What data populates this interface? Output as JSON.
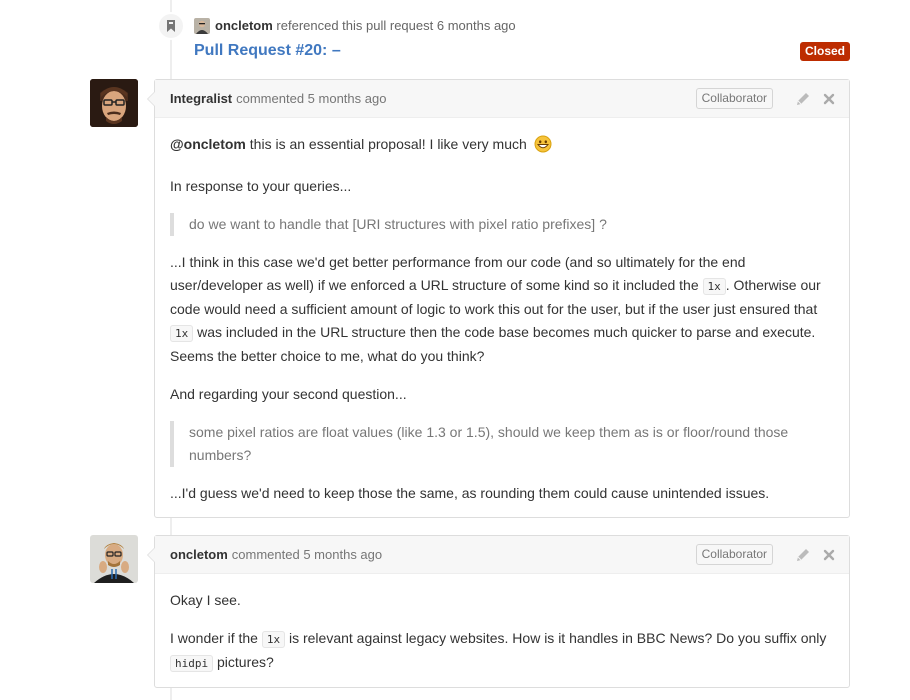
{
  "reference_event": {
    "author": "oncletom",
    "action": "referenced this pull request",
    "time": "6 months ago",
    "title": "Pull Request #20: –",
    "state": "Closed"
  },
  "comments": [
    {
      "author": "Integralist",
      "action": "commented",
      "time": "5 months ago",
      "role": "Collaborator",
      "mention": "@oncletom",
      "p1": " this is an essential proposal! I like very much ",
      "p2": "In response to your queries...",
      "quote1": "do we want to handle that [URI structures with pixel ratio prefixes] ?",
      "p3a": "...I think in this case we'd get better performance from our code (and so ultimately for the end user/developer as well) if we enforced a URL structure of some kind so it included the ",
      "code1": "1x",
      "p3b": ". Otherwise our code would need a sufficient amount of logic to work this out for the user, but if the user just ensured that ",
      "code2": "1x",
      "p3c": " was included in the URL structure then the code base becomes much quicker to parse and execute. Seems the better choice to me, what do you think?",
      "p4": "And regarding your second question...",
      "quote2": "some pixel ratios are float values (like 1.3 or 1.5), should we keep them as is or floor/round those numbers?",
      "p5": "...I'd guess we'd need to keep those the same, as rounding them could cause unintended issues."
    },
    {
      "author": "oncletom",
      "action": "commented",
      "time": "5 months ago",
      "role": "Collaborator",
      "p1": "Okay I see.",
      "p2a": "I wonder if the ",
      "code1": "1x",
      "p2b": " is relevant against legacy websites. How is it handles in BBC News? Do you suffix only ",
      "code2": "hidpi",
      "p2c": " pictures?"
    }
  ],
  "colors": {
    "link": "#4078c0",
    "closed_badge": "#bd2c00",
    "header_bg": "#f7f7f7",
    "border": "#dddddd"
  },
  "icons": [
    "bookmark-icon",
    "pencil-icon",
    "close-icon",
    "smile-emoji-icon"
  ]
}
